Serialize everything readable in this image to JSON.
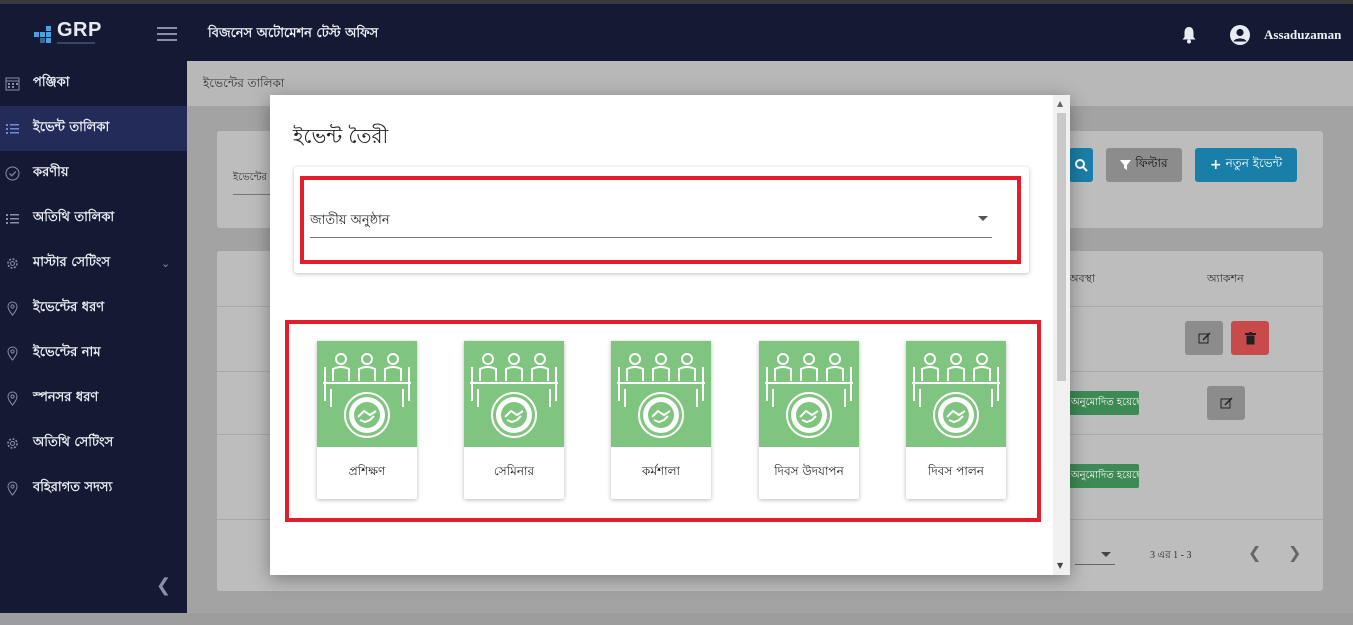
{
  "header": {
    "logo_text": "GRP",
    "office_name": "বিজনেস অটোমেশন টেস্ট অফিস",
    "user_name": "Assaduzaman"
  },
  "sidebar": {
    "items": [
      {
        "label": "পঞ্জিকা",
        "icon": "calendar-icon"
      },
      {
        "label": "ইভেন্ট তালিকা",
        "icon": "list-icon",
        "active": true
      },
      {
        "label": "করণীয়",
        "icon": "check-circle-icon"
      },
      {
        "label": "অতিথি তালিকা",
        "icon": "list-icon"
      },
      {
        "label": "মাস্টার সেটিংস",
        "icon": "gear-icon",
        "expandable": true
      },
      {
        "label": "ইভেন্টের ধরণ",
        "icon": "location-pin-icon"
      },
      {
        "label": "ইভেন্টের নাম",
        "icon": "location-pin-icon"
      },
      {
        "label": "স্পনসর ধরণ",
        "icon": "location-pin-icon"
      },
      {
        "label": "অতিথি সেটিংস",
        "icon": "gear-icon"
      },
      {
        "label": "বহিরাগত সদস্য",
        "icon": "location-pin-icon"
      }
    ]
  },
  "page": {
    "breadcrumb": "ইভেন্টের তালিকা",
    "search_label_fragment": "ইভেন্টের",
    "filter_button": "ফিল্টার",
    "new_event_button": "নতুন ইভেন্ট",
    "table_headers": {
      "status": "অবস্থা",
      "action": "অ্যাকশন"
    },
    "status_badges": [
      "অনুমোদিত হয়েছে",
      "অনুমোদিত হয়েছে"
    ],
    "pagination_text": "3 এর 1 - 3"
  },
  "modal": {
    "title": "ইভেন্ট তৈরী",
    "select_value": "জাতীয় অনুষ্ঠান",
    "tiles": [
      {
        "label": "প্রশিক্ষণ"
      },
      {
        "label": "সেমিনার"
      },
      {
        "label": "কর্মশালা"
      },
      {
        "label": "দিবস উদযাপন"
      },
      {
        "label": "দিবস পালন"
      }
    ]
  },
  "colors": {
    "nav_bg": "#141a33",
    "nav_active": "#232c58",
    "highlight": "#e31e2a",
    "tile_green": "#7fc47f",
    "primary_btn": "#1a8fc0",
    "badge_green": "#3e8a54",
    "delete_red": "#c94a4a"
  }
}
